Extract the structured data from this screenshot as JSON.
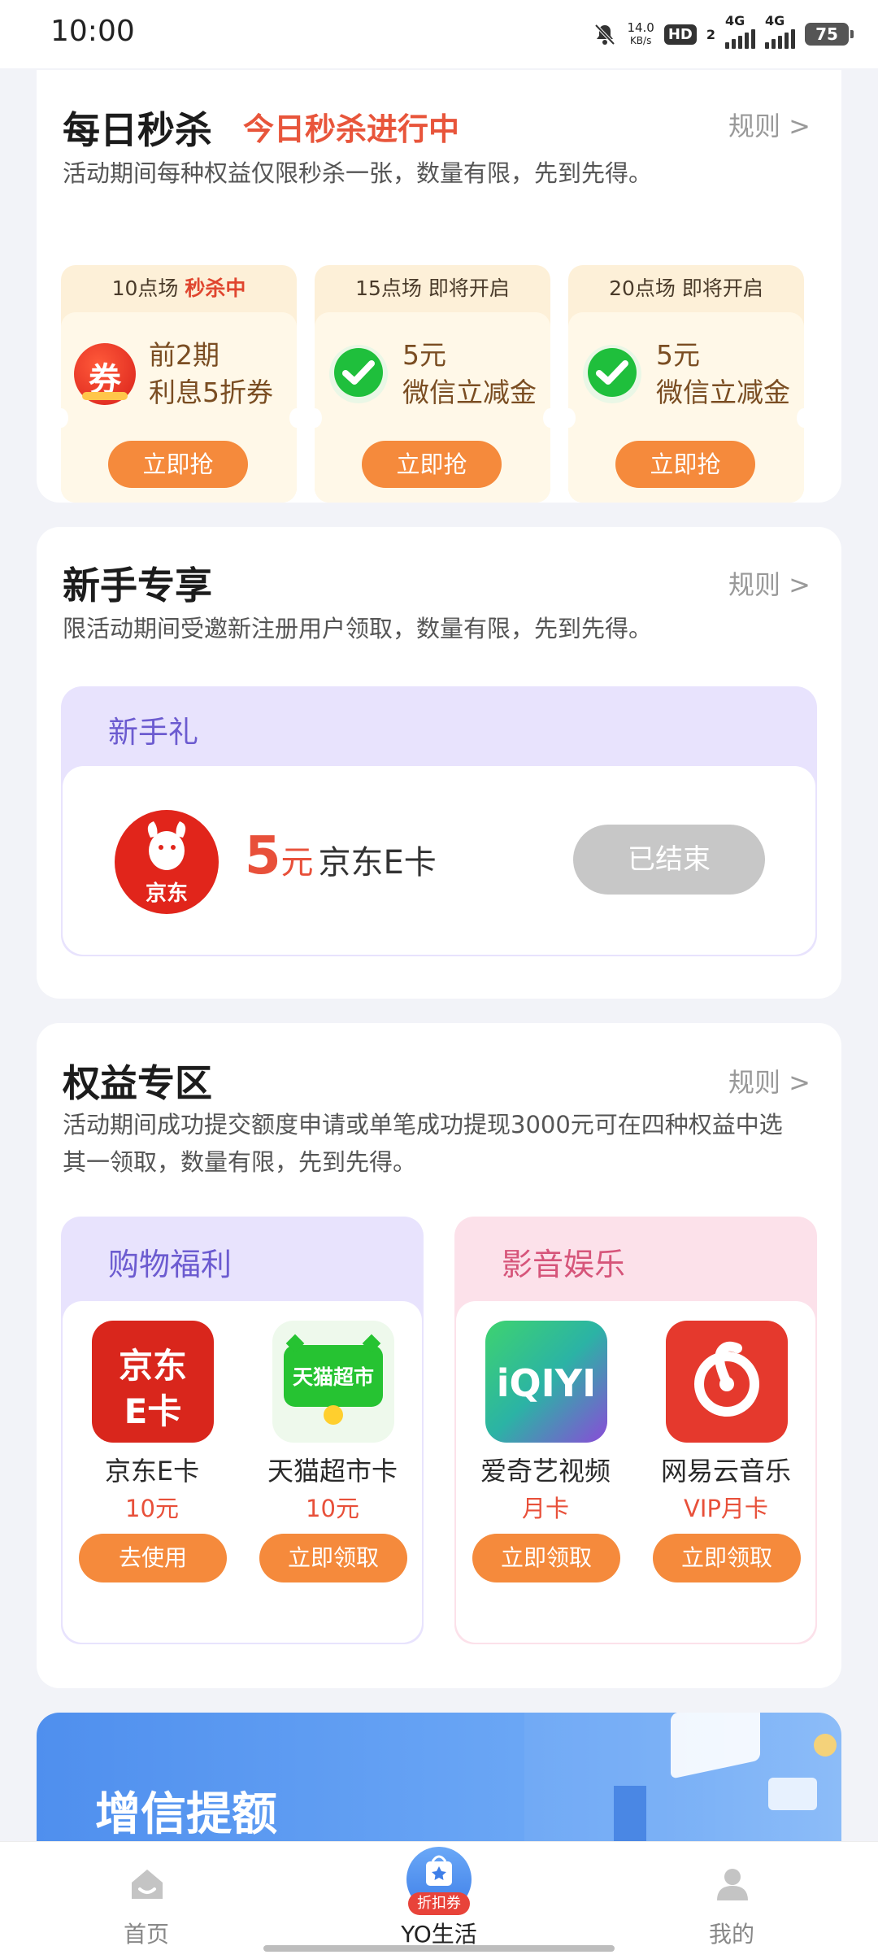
{
  "status_bar": {
    "time": "10:00",
    "net_speed_value": "14.0",
    "net_speed_unit": "KB/s",
    "hd_badge": "HD",
    "sim2_label": "2",
    "sig1_label": "4G",
    "sig2_label": "4G",
    "battery": "75"
  },
  "flash_sale": {
    "title": "每日秒杀",
    "status": "今日秒杀进行中",
    "rule": "规则 >",
    "desc": "活动期间每种权益仅限秒杀一张，数量有限，先到先得。",
    "sessions": [
      {
        "time": "10点场",
        "state": "秒杀中",
        "line1": "前2期",
        "line2": "利息5折券",
        "button": "立即抢",
        "icon": "coupon-icon",
        "icon_text": "券"
      },
      {
        "time": "15点场",
        "state": "即将开启",
        "line1": "5元",
        "line2": "微信立减金",
        "button": "立即抢",
        "icon": "wechat-icon"
      },
      {
        "time": "20点场",
        "state": "即将开启",
        "line1": "5元",
        "line2": "微信立减金",
        "button": "立即抢",
        "icon": "wechat-icon"
      }
    ]
  },
  "newbie": {
    "title": "新手专享",
    "rule": "规则 >",
    "desc": "限活动期间受邀新注册用户领取，数量有限，先到先得。",
    "gift_title": "新手礼",
    "logo_text": "京东",
    "amount": "5",
    "unit": "元",
    "product": "京东E卡",
    "button": "已结束"
  },
  "rights": {
    "title": "权益专区",
    "rule": "规则 >",
    "desc_line1": "活动期间成功提交额度申请或单笔成功提现3000元可在四种权益中选",
    "desc_line2": "其一领取，数量有限，先到先得。",
    "shopping": {
      "title": "购物福利",
      "items": [
        {
          "name": "京东E卡",
          "sub": "10元",
          "button": "去使用",
          "icon_text1": "京东",
          "icon_text2": "E卡"
        },
        {
          "name": "天猫超市卡",
          "sub": "10元",
          "button": "立即领取",
          "icon_text": "天猫超市"
        }
      ]
    },
    "media": {
      "title": "影音娱乐",
      "items": [
        {
          "name": "爱奇艺视频",
          "sub": "月卡",
          "button": "立即领取",
          "icon_text": "iQIYI"
        },
        {
          "name": "网易云音乐",
          "sub": "VIP月卡",
          "button": "立即领取"
        }
      ]
    }
  },
  "banner": {
    "title": "增信提额"
  },
  "bottom_nav": {
    "items": [
      {
        "label": "首页"
      },
      {
        "label": "YO生活",
        "badge": "折扣券"
      },
      {
        "label": "我的"
      }
    ]
  },
  "colors": {
    "accent_orange": "#f58a3c",
    "red": "#e8503a",
    "purple": "#6c5bd0",
    "pink": "#d6557a"
  }
}
